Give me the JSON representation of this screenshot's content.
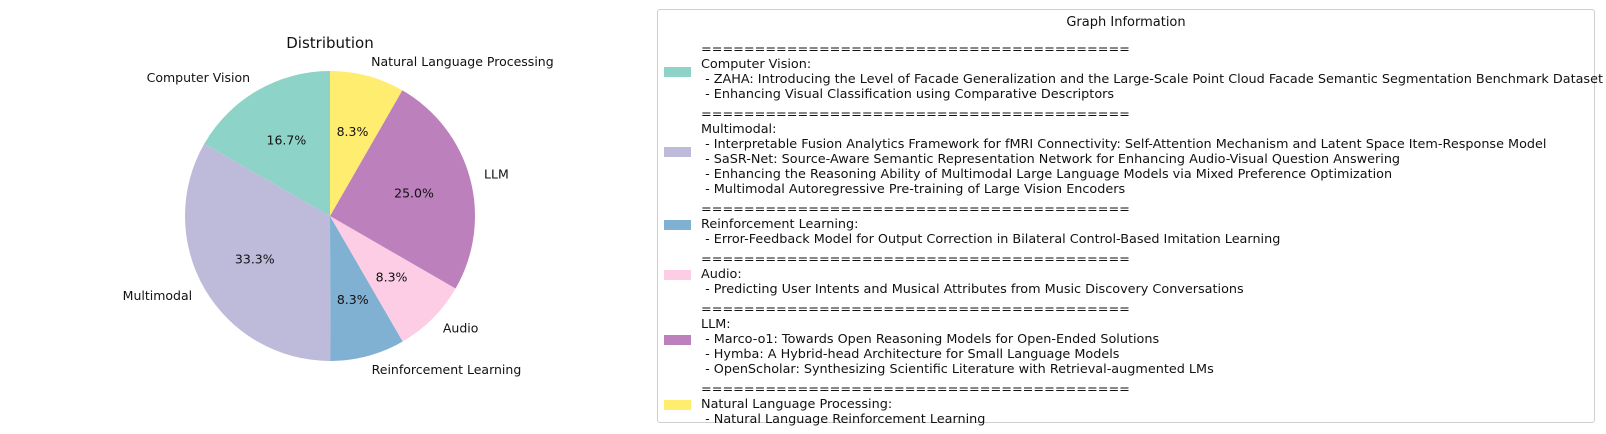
{
  "chart_data": {
    "type": "pie",
    "title": "Distribution",
    "slices": [
      {
        "label": "Computer Vision",
        "value": 16.7,
        "display": "16.7%",
        "color": "#8dd3c7"
      },
      {
        "label": "Multimodal",
        "value": 33.3,
        "display": "33.3%",
        "color": "#bebada"
      },
      {
        "label": "Reinforcement Learning",
        "value": 8.3,
        "display": "8.3%",
        "color": "#80b1d3"
      },
      {
        "label": "Audio",
        "value": 8.3,
        "display": "8.3%",
        "color": "#fccde5"
      },
      {
        "label": "LLM",
        "value": 25.0,
        "display": "25.0%",
        "color": "#bc80bd"
      },
      {
        "label": "Natural Language Processing",
        "value": 8.3,
        "display": "8.3%",
        "color": "#ffed6f"
      }
    ],
    "start_angle_deg": 90,
    "direction": "counterclockwise"
  },
  "legend": {
    "title": "Graph Information",
    "separator": "========================================",
    "entries": [
      {
        "category": "Computer Vision:",
        "color": "#8dd3c7",
        "items": [
          " - ZAHA: Introducing the Level of Facade Generalization and the Large-Scale Point Cloud Facade Semantic Segmentation Benchmark Dataset",
          " - Enhancing Visual Classification using Comparative Descriptors"
        ]
      },
      {
        "category": "Multimodal:",
        "color": "#bebada",
        "items": [
          " - Interpretable Fusion Analytics Framework for fMRI Connectivity: Self-Attention Mechanism and Latent Space Item-Response Model",
          " - SaSR-Net: Source-Aware Semantic Representation Network for Enhancing Audio-Visual Question Answering",
          " - Enhancing the Reasoning Ability of Multimodal Large Language Models via Mixed Preference Optimization",
          " - Multimodal Autoregressive Pre-training of Large Vision Encoders"
        ]
      },
      {
        "category": "Reinforcement Learning:",
        "color": "#80b1d3",
        "items": [
          " - Error-Feedback Model for Output Correction in Bilateral Control-Based Imitation Learning"
        ]
      },
      {
        "category": "Audio:",
        "color": "#fccde5",
        "items": [
          " - Predicting User Intents and Musical Attributes from Music Discovery Conversations"
        ]
      },
      {
        "category": "LLM:",
        "color": "#bc80bd",
        "items": [
          " - Marco-o1: Towards Open Reasoning Models for Open-Ended Solutions",
          " - Hymba: A Hybrid-head Architecture for Small Language Models",
          " - OpenScholar: Synthesizing Scientific Literature with Retrieval-augmented LMs"
        ]
      },
      {
        "category": "Natural Language Processing:",
        "color": "#ffed6f",
        "items": [
          " - Natural Language Reinforcement Learning"
        ]
      }
    ]
  }
}
